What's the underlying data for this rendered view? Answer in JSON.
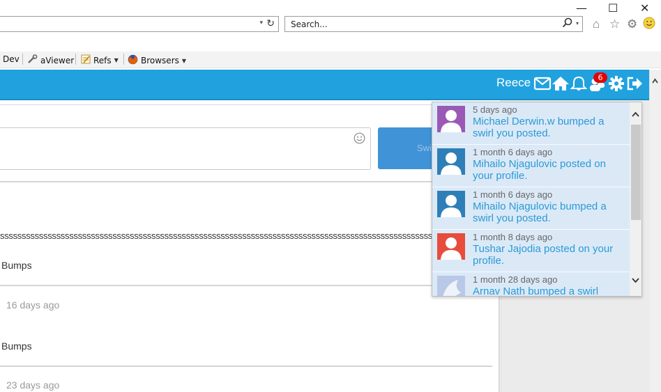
{
  "window": {
    "minimize": "—",
    "maximize": "☐",
    "close": "✕"
  },
  "address_bar": {
    "refresh": "↻",
    "dropdown": "▾"
  },
  "search_bar": {
    "placeholder": "Search...",
    "icon": "search-icon"
  },
  "toolbar_icons": [
    "home-icon",
    "star-icon",
    "gear-icon",
    "smiley-icon"
  ],
  "favorites": [
    {
      "label": "Dev",
      "icon": null,
      "has_dropdown": false
    },
    {
      "label": "aViewer",
      "icon": "wrench-icon",
      "has_dropdown": false
    },
    {
      "label": "Refs",
      "icon": "notepad-icon",
      "has_dropdown": true
    },
    {
      "label": "Browsers",
      "icon": "firefox-icon",
      "has_dropdown": true
    }
  ],
  "header": {
    "username": "Reece",
    "icons": [
      "mail-icon",
      "home-icon",
      "bell-icon",
      "friends-icon",
      "gear-icon",
      "logout-icon"
    ],
    "friends_badge": "6",
    "accent": "#21a2df"
  },
  "composer": {
    "button_label": "Swirl",
    "emoji_icon": "smiley-icon"
  },
  "feed": {
    "long_text": "sssssssssssssssssssssssssssssssssssssssssssssssssssssssssssssssssssssssssssssssssssssssssssssssssssssssssssssssssssssss",
    "items": [
      {
        "bumps": "Bumps"
      },
      {
        "ago": "16 days ago",
        "bumps": "Bumps"
      },
      {
        "ago": "23 days ago"
      }
    ]
  },
  "notifications": [
    {
      "time": "5 days ago",
      "text": "Michael Derwin.w bumped a swirl you posted.",
      "avatar_color": "#9b59b6"
    },
    {
      "time": "1 month 6 days ago",
      "text": "Mihailo Njagulovic posted on your profile.",
      "avatar_color": "#2e7fb8"
    },
    {
      "time": "1 month 6 days ago",
      "text": "Mihailo Njagulovic bumped a swirl you posted.",
      "avatar_color": "#2e7fb8"
    },
    {
      "time": "1 month 8 days ago",
      "text": "Tushar Jajodia posted on your profile.",
      "avatar_color": "#e74c3c"
    },
    {
      "time": "1 month 28 days ago",
      "text": "Arnav Nath bumped a swirl",
      "avatar_color": "#7f95c4"
    }
  ]
}
